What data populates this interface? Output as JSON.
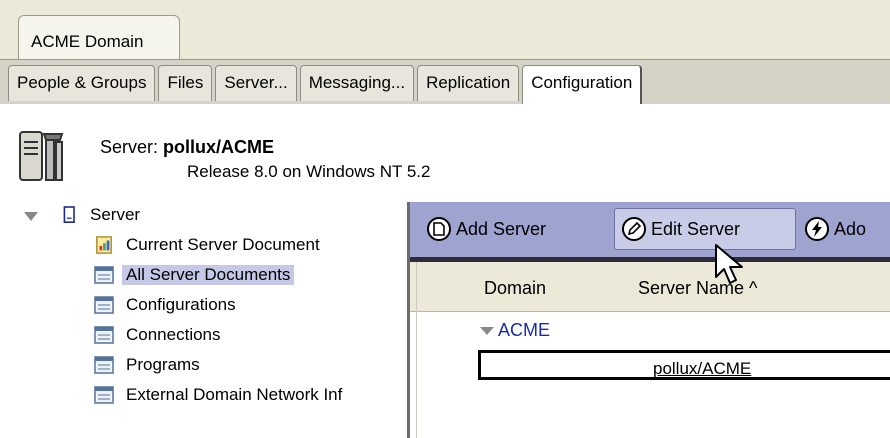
{
  "domain_tab": {
    "label": "ACME Domain"
  },
  "task_tabs": [
    {
      "label": "People & Groups"
    },
    {
      "label": "Files"
    },
    {
      "label": "Server..."
    },
    {
      "label": "Messaging..."
    },
    {
      "label": "Replication"
    },
    {
      "label": "Configuration"
    }
  ],
  "active_task_tab": "Configuration",
  "server_header": {
    "label": "Server:",
    "name": "pollux/ACME",
    "release": "Release 8.0 on Windows NT 5.2",
    "icon": "server-icon"
  },
  "nav": {
    "root": "Server",
    "items": [
      {
        "label": "Current Server Document",
        "icon": "document-icon"
      },
      {
        "label": "All Server Documents",
        "icon": "view-icon",
        "selected": true
      },
      {
        "label": "Configurations",
        "icon": "view-icon"
      },
      {
        "label": "Connections",
        "icon": "view-icon"
      },
      {
        "label": "Programs",
        "icon": "view-icon"
      },
      {
        "label": "External Domain Network Inf",
        "icon": "view-icon"
      }
    ]
  },
  "actions": [
    {
      "label": "Add Server",
      "icon": "add-document-icon"
    },
    {
      "label": "Edit Server",
      "icon": "pencil-icon"
    },
    {
      "label": "Ado",
      "icon": "lightning-icon"
    }
  ],
  "view": {
    "columns": [
      {
        "label": "Domain"
      },
      {
        "label": "Server Name ^"
      }
    ],
    "category": "ACME",
    "rows": [
      {
        "server_name": "pollux/ACME"
      }
    ]
  },
  "colors": {
    "action_bar": "#9ea3cf",
    "selection": "#c5c8e6",
    "category_text": "#1b2ea0"
  }
}
